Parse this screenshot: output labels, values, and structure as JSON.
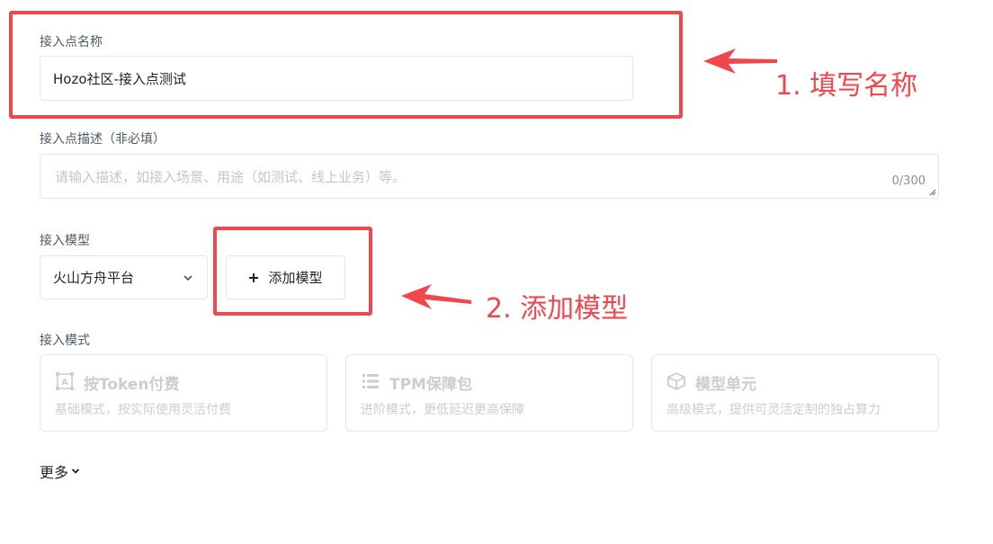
{
  "form": {
    "name_label": "接入点名称",
    "name_value": "Hozo社区-接入点测试",
    "desc_label": "接入点描述（非必填）",
    "desc_placeholder": "请输入描述，如接入场景、用途（如测试、线上业务）等。",
    "desc_counter": "0/300",
    "model_label": "接入模型",
    "model_select_value": "火山方舟平台",
    "add_model_label": "添加模型",
    "mode_label": "接入模式",
    "modes": [
      {
        "title": "按Token付费",
        "desc": "基础模式，按实际使用灵活付费",
        "icon": "token-icon"
      },
      {
        "title": "TPM保障包",
        "desc": "进阶模式，更低延迟更高保障",
        "icon": "server-icon"
      },
      {
        "title": "模型单元",
        "desc": "高级模式，提供可灵活定制的独占算力",
        "icon": "cube-icon"
      }
    ],
    "more_label": "更多"
  },
  "annotations": {
    "step1": "1. 填写名称",
    "step2": "2. 添加模型",
    "color": "#f0474d"
  }
}
